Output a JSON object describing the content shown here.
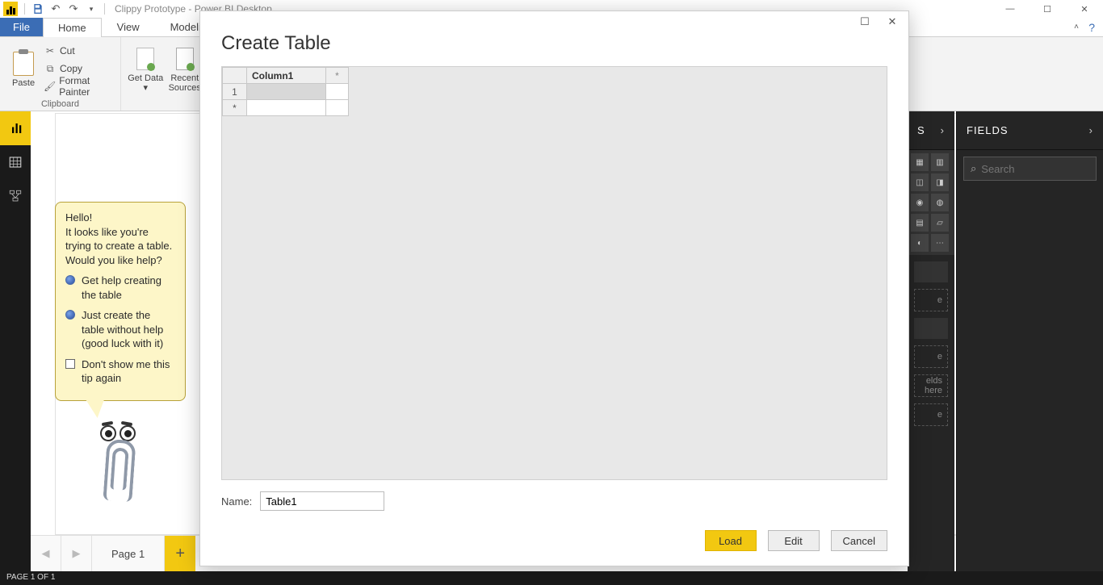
{
  "titlebar": {
    "app_title": "Clippy Prototype - Power BI Desktop"
  },
  "ribbon": {
    "file": "File",
    "tabs": [
      "Home",
      "View",
      "Modeling"
    ],
    "active_tab": "Home",
    "clipboard": {
      "group": "Clipboard",
      "paste": "Paste",
      "cut": "Cut",
      "copy": "Copy",
      "format_painter": "Format Painter"
    },
    "data": {
      "get_data": "Get Data",
      "recent_sources": "Recent Sources"
    }
  },
  "clippy": {
    "greeting": "Hello!",
    "message": "It looks like you're trying to create a table. Would you like help?",
    "option1": "Get help creating the table",
    "option2": "Just create the table without help (good luck with it)",
    "option3": "Don't show me this tip again"
  },
  "modal": {
    "title": "Create Table",
    "column_header": "Column1",
    "row1": "1",
    "star": "*",
    "name_label": "Name:",
    "name_value": "Table1",
    "load": "Load",
    "edit": "Edit",
    "cancel": "Cancel"
  },
  "pages": {
    "page1": "Page 1"
  },
  "status": {
    "text": "PAGE 1 OF 1"
  },
  "fields": {
    "header": "FIELDS",
    "search_placeholder": "Search",
    "drop_hint": "elds here"
  },
  "viz": {
    "header_partial": "S"
  }
}
